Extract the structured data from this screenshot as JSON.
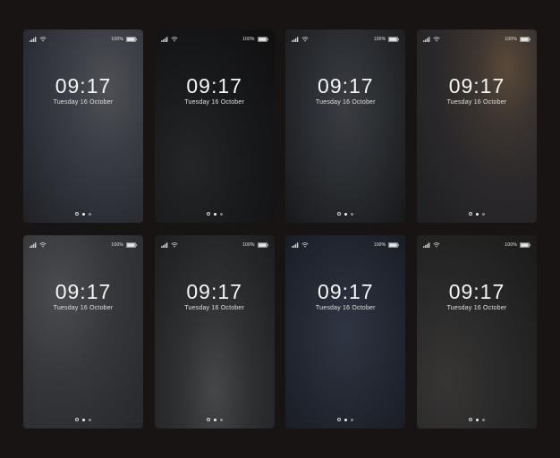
{
  "status": {
    "battery_percent": "100%"
  },
  "lock": {
    "time": "09:17",
    "date": "Tuesday 16 October"
  },
  "screens": [
    {
      "bg": "bg1"
    },
    {
      "bg": "bg2"
    },
    {
      "bg": "bg3"
    },
    {
      "bg": "bg4"
    },
    {
      "bg": "bg5"
    },
    {
      "bg": "bg6"
    },
    {
      "bg": "bg7"
    },
    {
      "bg": "bg8"
    }
  ]
}
